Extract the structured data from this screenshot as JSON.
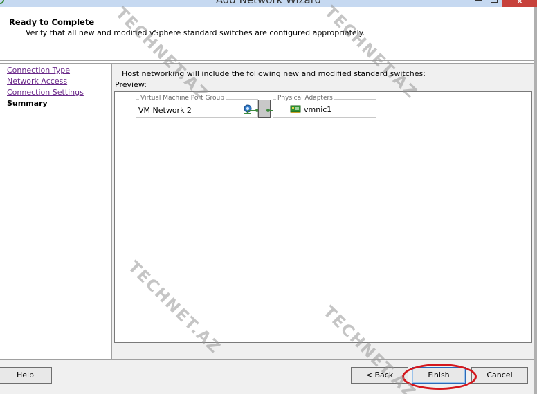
{
  "window": {
    "title": "Add Network Wizard",
    "close_glyph": "✕"
  },
  "header": {
    "title": "Ready to Complete",
    "subtitle": "Verify that all new and modified vSphere standard switches are configured appropriately."
  },
  "sidebar": {
    "items": [
      {
        "label": "Connection Type",
        "state": "link"
      },
      {
        "label": "Network Access",
        "state": "link"
      },
      {
        "label": "Connection Settings",
        "state": "link"
      },
      {
        "label": "Summary",
        "state": "current"
      }
    ]
  },
  "main": {
    "intro": "Host networking will include the following new and modified standard switches:",
    "preview_label": "Preview:",
    "port_group": {
      "legend": "Virtual Machine Port Group",
      "name": "VM Network 2",
      "icon": "vm-network-icon"
    },
    "physical_adapters": {
      "legend": "Physical Adapters",
      "name": "vmnic1",
      "icon": "nic-icon"
    }
  },
  "footer": {
    "help": "Help",
    "back": "< Back",
    "finish": "Finish",
    "cancel": "Cancel"
  },
  "watermark": "TECHNET.AZ",
  "colors": {
    "link": "#6b2a8a",
    "highlight": "#d4171d",
    "wire": "#3d8a3d"
  }
}
